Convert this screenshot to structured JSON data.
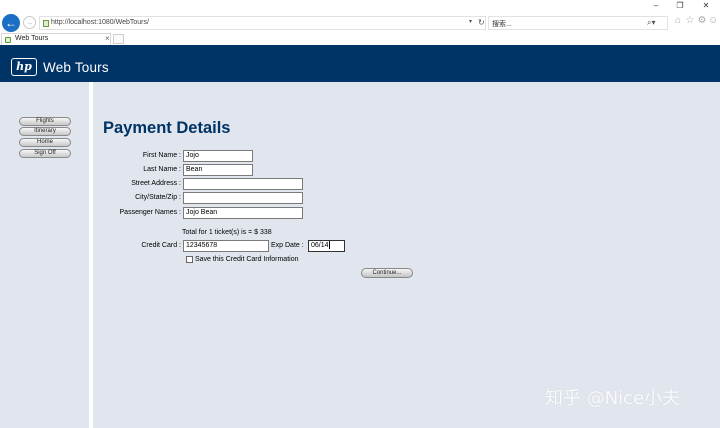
{
  "browser": {
    "window_controls": {
      "minimize": "–",
      "restore": "❐",
      "close": "✕"
    },
    "back_icon": "←",
    "forward_icon": "→",
    "url": "http://localhost:1080/WebTours/",
    "url_dropdown": "▾",
    "refresh_icon": "↻",
    "search_placeholder": "搜索...",
    "search_icon": "⌕▾",
    "home_icon": "⌂",
    "favorites_icon": "☆",
    "settings_icon": "⚙",
    "smiley_icon": "☺",
    "tab": {
      "label": "Web Tours",
      "close": "×"
    }
  },
  "site": {
    "logo_text": "hp",
    "title": "Web Tours",
    "header_color": "#003366",
    "background_color": "#e0e5ee"
  },
  "nav": {
    "items": [
      {
        "label": "Flights"
      },
      {
        "label": "Itinerary"
      },
      {
        "label": "Home"
      },
      {
        "label": "Sign Off"
      }
    ]
  },
  "form": {
    "title": "Payment Details",
    "first_name": {
      "label": "First Name :",
      "value": "Jojo"
    },
    "last_name": {
      "label": "Last Name :",
      "value": "Bean"
    },
    "street_address": {
      "label": "Street Address :",
      "value": ""
    },
    "city_state_zip": {
      "label": "City/State/Zip :",
      "value": ""
    },
    "passenger_names": {
      "label": "Passenger Names :",
      "value": "Jojo Bean"
    },
    "total": "Total for 1 ticket(s) is = $ 338",
    "credit_card": {
      "label": "Credit Card :",
      "value": "12345678"
    },
    "exp_date": {
      "label": "Exp Date :",
      "value": "06/14"
    },
    "save_card": {
      "label": "Save this Credit Card Information",
      "checked": false
    },
    "continue_label": "Continue..."
  },
  "watermark": "知乎 @Nice小夫"
}
